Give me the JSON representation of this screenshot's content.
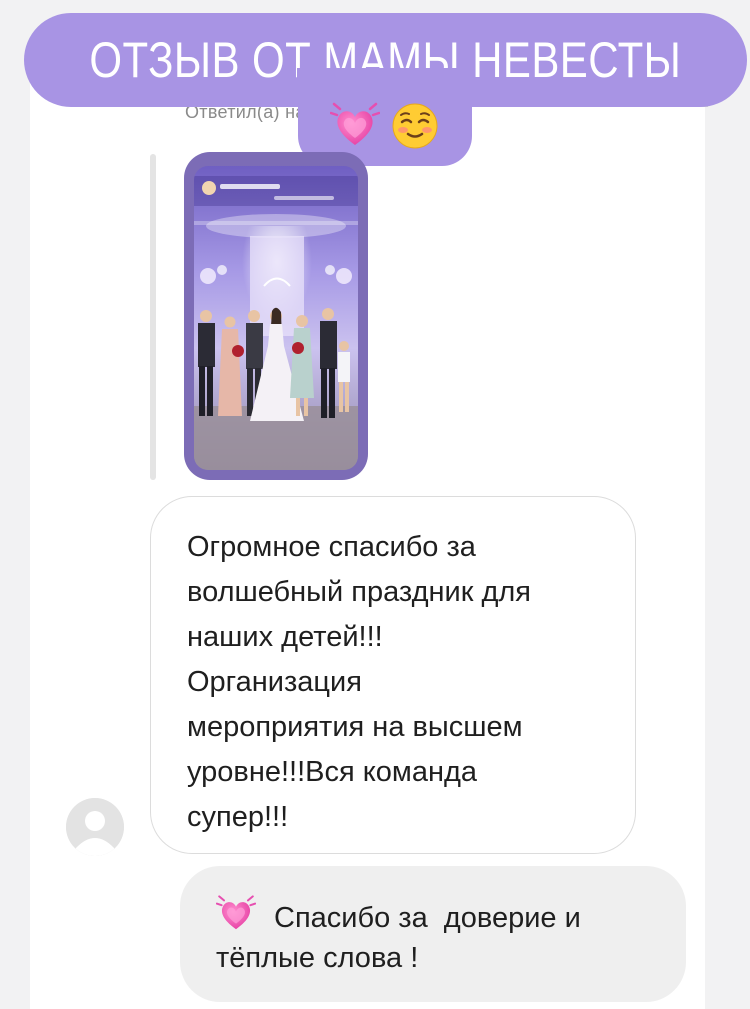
{
  "header": {
    "title": "ОТЗЫВ ОТ МАМЫ НЕВЕСТЫ",
    "pill_color": "#a894e4",
    "emojis": [
      "heart-pulse-icon",
      "smiling-face-icon"
    ]
  },
  "story": {
    "replied_label": "Ответил(а) на вашу историю",
    "frame_color": "#7c6cb6"
  },
  "message": {
    "lines": [
      "Огромное спасибо за",
      "волшебный праздник для",
      "наших детей!!!",
      "Организация",
      "мероприятия на высшем",
      "уровне!!!Вся команда",
      "супер!!!"
    ]
  },
  "reply": {
    "icon": "heart-pulse-icon",
    "line1": "Спасибо за  доверие и",
    "line2": "тёплые слова !"
  }
}
